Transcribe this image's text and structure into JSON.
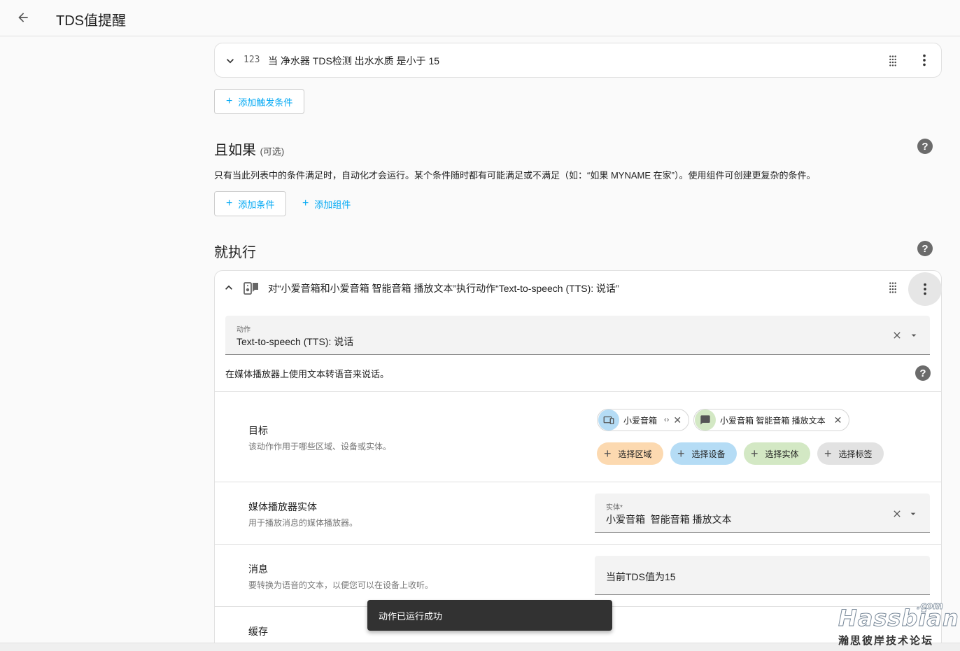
{
  "header": {
    "title": "TDS值提醒"
  },
  "trigger": {
    "badge": "123",
    "summary": "当 净水器 TDS检测 出水水质 是小于 15",
    "add_trigger_label": "添加触发条件"
  },
  "conditions": {
    "title": "且如果",
    "optional": "(可选)",
    "description": "只有当此列表中的条件满足时，自动化才会运行。某个条件随时都有可能满足或不满足（如：“如果 MYNAME 在家”）。使用组件可创建更复杂的条件。",
    "add_condition_label": "添加条件",
    "add_building_block_label": "添加组件"
  },
  "actions": {
    "title": "就执行",
    "summary": "对“小爱音箱和小爱音箱 智能音箱 播放文本”执行动作“Text-to-speech (TTS): 说话”",
    "action_field_label": "动作",
    "action_field_value": "Text-to-speech (TTS): 说话",
    "action_description": "在媒体播放器上使用文本转语音来说话。",
    "target": {
      "title": "目标",
      "description": "该动作作用于哪些区域、设备或实体。",
      "chips": [
        {
          "label": "小爱音箱"
        },
        {
          "label": "小爱音箱 智能音箱 播放文本"
        }
      ],
      "add_buttons": {
        "area": "选择区域",
        "device": "选择设备",
        "entity": "选择实体",
        "label": "选择标签"
      }
    },
    "media_player": {
      "title": "媒体播放器实体",
      "description": "用于播放消息的媒体播放器。",
      "field_label": "实体*",
      "field_value": "小爱音箱  智能音箱 播放文本"
    },
    "message": {
      "title": "消息",
      "description": "要转换为语音的文本，以便您可以在设备上收听。",
      "field_value": "当前TDS值为15"
    },
    "cache": {
      "title": "缓存"
    }
  },
  "toast": {
    "text": "动作已运行成功"
  },
  "watermark": {
    "logo": "Hassbian",
    "suffix": ".com",
    "subtitle": "瀚思彼岸技术论坛"
  },
  "colors": {
    "accent": "#03a9f4",
    "area_chip": "#fcd9b0",
    "device_chip": "#b5dcf5",
    "entity_chip": "#d3e8c4",
    "label_chip": "#e2e2e2"
  }
}
